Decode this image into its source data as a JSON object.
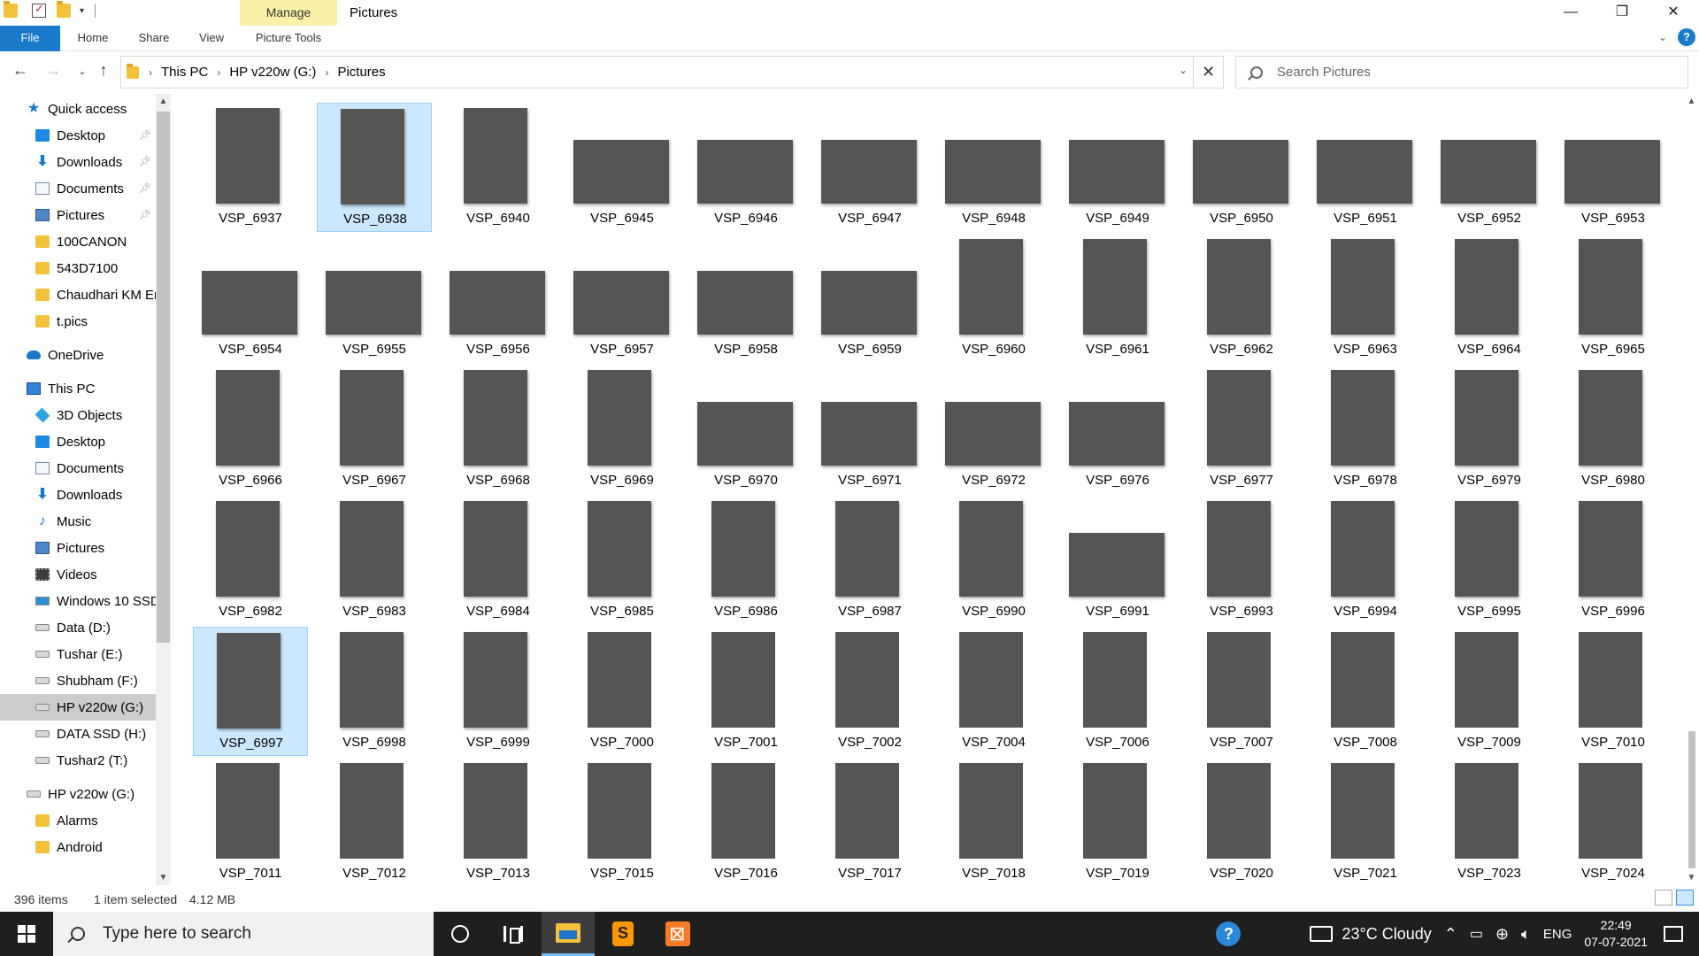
{
  "window": {
    "title": "Pictures",
    "manage_tab": "Manage",
    "controls": [
      "minimize",
      "restore",
      "close"
    ]
  },
  "ribbon": {
    "tabs": [
      "File",
      "Home",
      "Share",
      "View",
      "Picture Tools"
    ]
  },
  "address": {
    "crumbs": [
      "This PC",
      "HP v220w (G:)",
      "Pictures"
    ],
    "search_placeholder": "Search Pictures"
  },
  "nav": {
    "items": [
      {
        "label": "Quick access",
        "icon": "star-icon",
        "indent": 1,
        "pinned": false
      },
      {
        "label": "Desktop",
        "icon": "desktop-icon",
        "indent": 2,
        "pinned": true
      },
      {
        "label": "Downloads",
        "icon": "download-icon",
        "indent": 2,
        "pinned": true
      },
      {
        "label": "Documents",
        "icon": "documents-icon",
        "indent": 2,
        "pinned": true
      },
      {
        "label": "Pictures",
        "icon": "pictures-icon",
        "indent": 2,
        "pinned": true
      },
      {
        "label": "100CANON",
        "icon": "folder-icon",
        "indent": 2,
        "pinned": false
      },
      {
        "label": "543D7100",
        "icon": "folder-icon",
        "indent": 2,
        "pinned": false
      },
      {
        "label": "Chaudhari KM Er",
        "icon": "folder-icon",
        "indent": 2,
        "pinned": false
      },
      {
        "label": "t.pics",
        "icon": "folder-icon",
        "indent": 2,
        "pinned": false
      },
      {
        "label": "OneDrive",
        "icon": "onedrive-icon",
        "indent": 1,
        "pinned": false,
        "gap": true
      },
      {
        "label": "This PC",
        "icon": "this-pc-icon",
        "indent": 1,
        "pinned": false,
        "gap": true
      },
      {
        "label": "3D Objects",
        "icon": "3d-objects-icon",
        "indent": 2,
        "pinned": false
      },
      {
        "label": "Desktop",
        "icon": "desktop-icon",
        "indent": 2,
        "pinned": false
      },
      {
        "label": "Documents",
        "icon": "documents-icon",
        "indent": 2,
        "pinned": false
      },
      {
        "label": "Downloads",
        "icon": "download-icon",
        "indent": 2,
        "pinned": false
      },
      {
        "label": "Music",
        "icon": "music-icon",
        "indent": 2,
        "pinned": false
      },
      {
        "label": "Pictures",
        "icon": "pictures-icon",
        "indent": 2,
        "pinned": false
      },
      {
        "label": "Videos",
        "icon": "videos-icon",
        "indent": 2,
        "pinned": false
      },
      {
        "label": "Windows 10 SSD",
        "icon": "windows-drive-icon",
        "indent": 2,
        "pinned": false
      },
      {
        "label": "Data (D:)",
        "icon": "drive-icon",
        "indent": 2,
        "pinned": false
      },
      {
        "label": "Tushar (E:)",
        "icon": "drive-icon",
        "indent": 2,
        "pinned": false
      },
      {
        "label": "Shubham (F:)",
        "icon": "drive-icon",
        "indent": 2,
        "pinned": false
      },
      {
        "label": "HP v220w (G:)",
        "icon": "drive-icon",
        "indent": 2,
        "pinned": false,
        "selected": true
      },
      {
        "label": "DATA SSD (H:)",
        "icon": "drive-icon",
        "indent": 2,
        "pinned": false
      },
      {
        "label": "Tushar2 (T:)",
        "icon": "drive-icon",
        "indent": 2,
        "pinned": false
      },
      {
        "label": "HP v220w (G:)",
        "icon": "drive-icon",
        "indent": 1,
        "pinned": false,
        "gap": true
      },
      {
        "label": "Alarms",
        "icon": "folder-icon",
        "indent": 2,
        "pinned": false
      },
      {
        "label": "Android",
        "icon": "folder-icon",
        "indent": 2,
        "pinned": false
      }
    ]
  },
  "files": [
    {
      "name": "VSP_6937",
      "orient": "port",
      "thumb": "g-mom"
    },
    {
      "name": "VSP_6938",
      "orient": "port",
      "thumb": "g-mom",
      "selected": true
    },
    {
      "name": "VSP_6940",
      "orient": "port",
      "thumb": "g-mom"
    },
    {
      "name": "VSP_6945",
      "orient": "land",
      "thumb": "g-girlred"
    },
    {
      "name": "VSP_6946",
      "orient": "land",
      "thumb": "g-girlred"
    },
    {
      "name": "VSP_6947",
      "orient": "land",
      "thumb": "g-bath"
    },
    {
      "name": "VSP_6948",
      "orient": "land",
      "thumb": "g-bath"
    },
    {
      "name": "VSP_6949",
      "orient": "land",
      "thumb": "g-bath"
    },
    {
      "name": "VSP_6950",
      "orient": "land",
      "thumb": "g-flare"
    },
    {
      "name": "VSP_6951",
      "orient": "land",
      "thumb": "g-bath"
    },
    {
      "name": "VSP_6952",
      "orient": "land",
      "thumb": "g-bath"
    },
    {
      "name": "VSP_6953",
      "orient": "land",
      "thumb": "g-bath"
    },
    {
      "name": "VSP_6954",
      "orient": "land",
      "thumb": "g-splash"
    },
    {
      "name": "VSP_6955",
      "orient": "land",
      "thumb": "g-splash"
    },
    {
      "name": "VSP_6956",
      "orient": "land",
      "thumb": "g-splash"
    },
    {
      "name": "VSP_6957",
      "orient": "land",
      "thumb": "g-splash"
    },
    {
      "name": "VSP_6958",
      "orient": "land",
      "thumb": "g-splash"
    },
    {
      "name": "VSP_6959",
      "orient": "land",
      "thumb": "g-splash"
    },
    {
      "name": "VSP_6960",
      "orient": "port",
      "thumb": "g-pour"
    },
    {
      "name": "VSP_6961",
      "orient": "port",
      "thumb": "g-pour"
    },
    {
      "name": "VSP_6962",
      "orient": "port",
      "thumb": "g-pour"
    },
    {
      "name": "VSP_6963",
      "orient": "port",
      "thumb": "g-pour"
    },
    {
      "name": "VSP_6964",
      "orient": "port",
      "thumb": "g-pour"
    },
    {
      "name": "VSP_6965",
      "orient": "port",
      "thumb": "g-pour"
    },
    {
      "name": "VSP_6966",
      "orient": "port",
      "thumb": "g-pourv"
    },
    {
      "name": "VSP_6967",
      "orient": "port",
      "thumb": "g-pourv"
    },
    {
      "name": "VSP_6968",
      "orient": "port",
      "thumb": "g-pourv"
    },
    {
      "name": "VSP_6969",
      "orient": "port",
      "thumb": "g-pourv"
    },
    {
      "name": "VSP_6970",
      "orient": "land",
      "thumb": "g-wash"
    },
    {
      "name": "VSP_6971",
      "orient": "land",
      "thumb": "g-wash"
    },
    {
      "name": "VSP_6972",
      "orient": "land",
      "thumb": "g-wash"
    },
    {
      "name": "VSP_6976",
      "orient": "land",
      "thumb": "g-washred"
    },
    {
      "name": "VSP_6977",
      "orient": "port",
      "thumb": "g-tub"
    },
    {
      "name": "VSP_6978",
      "orient": "port",
      "thumb": "g-tub"
    },
    {
      "name": "VSP_6979",
      "orient": "port",
      "thumb": "g-tub"
    },
    {
      "name": "VSP_6980",
      "orient": "port",
      "thumb": "g-tub"
    },
    {
      "name": "VSP_6982",
      "orient": "port",
      "thumb": "g-red"
    },
    {
      "name": "VSP_6983",
      "orient": "port",
      "thumb": "g-red"
    },
    {
      "name": "VSP_6984",
      "orient": "port",
      "thumb": "g-redsit"
    },
    {
      "name": "VSP_6985",
      "orient": "port",
      "thumb": "g-redsit"
    },
    {
      "name": "VSP_6986",
      "orient": "port",
      "thumb": "g-blue"
    },
    {
      "name": "VSP_6987",
      "orient": "port",
      "thumb": "g-blue"
    },
    {
      "name": "VSP_6990",
      "orient": "port",
      "thumb": "g-blue"
    },
    {
      "name": "VSP_6991",
      "orient": "land",
      "thumb": "g-bluedark"
    },
    {
      "name": "VSP_6993",
      "orient": "port",
      "thumb": "g-blueout"
    },
    {
      "name": "VSP_6994",
      "orient": "port",
      "thumb": "g-blueout"
    },
    {
      "name": "VSP_6995",
      "orient": "port",
      "thumb": "g-blueout"
    },
    {
      "name": "VSP_6996",
      "orient": "port",
      "thumb": "g-blueout"
    },
    {
      "name": "VSP_6997",
      "orient": "port",
      "thumb": "g-blueout",
      "selected": true
    },
    {
      "name": "VSP_6998",
      "orient": "port",
      "thumb": "g-blueout"
    },
    {
      "name": "VSP_6999",
      "orient": "port",
      "thumb": "g-blueout"
    },
    {
      "name": "VSP_7000",
      "orient": "port",
      "thumb": "g-blank"
    },
    {
      "name": "VSP_7001",
      "orient": "port",
      "thumb": "g-blank"
    },
    {
      "name": "VSP_7002",
      "orient": "port",
      "thumb": "g-blank"
    },
    {
      "name": "VSP_7004",
      "orient": "port",
      "thumb": "g-blank"
    },
    {
      "name": "VSP_7006",
      "orient": "port",
      "thumb": "g-blank"
    },
    {
      "name": "VSP_7007",
      "orient": "port",
      "thumb": "g-blank"
    },
    {
      "name": "VSP_7008",
      "orient": "port",
      "thumb": "g-blank"
    },
    {
      "name": "VSP_7009",
      "orient": "port",
      "thumb": "g-blank"
    },
    {
      "name": "VSP_7010",
      "orient": "port",
      "thumb": "g-blank"
    },
    {
      "name": "VSP_7011",
      "orient": "port",
      "thumb": "g-blank"
    },
    {
      "name": "VSP_7012",
      "orient": "port",
      "thumb": "g-blank"
    },
    {
      "name": "VSP_7013",
      "orient": "port",
      "thumb": "g-blank"
    },
    {
      "name": "VSP_7015",
      "orient": "port",
      "thumb": "g-blank"
    },
    {
      "name": "VSP_7016",
      "orient": "port",
      "thumb": "g-blank"
    },
    {
      "name": "VSP_7017",
      "orient": "port",
      "thumb": "g-blank"
    },
    {
      "name": "VSP_7018",
      "orient": "port",
      "thumb": "g-blank"
    },
    {
      "name": "VSP_7019",
      "orient": "port",
      "thumb": "g-blank"
    },
    {
      "name": "VSP_7020",
      "orient": "port",
      "thumb": "g-blank"
    },
    {
      "name": "VSP_7021",
      "orient": "port",
      "thumb": "g-blank"
    },
    {
      "name": "VSP_7023",
      "orient": "port",
      "thumb": "g-blank"
    },
    {
      "name": "VSP_7024",
      "orient": "port",
      "thumb": "g-blank"
    }
  ],
  "status": {
    "item_count": "396 items",
    "selection": "1 item selected",
    "size": "4.12 MB"
  },
  "taskbar": {
    "search_placeholder": "Type here to search",
    "weather": "23°C Cloudy",
    "language": "ENG",
    "time": "22:49",
    "date": "07-07-2021"
  },
  "colors": {
    "accent": "#1979ca",
    "selection": "#cce8ff",
    "manage_tab": "#fbf0a8",
    "taskbar": "#1f1f1f"
  }
}
